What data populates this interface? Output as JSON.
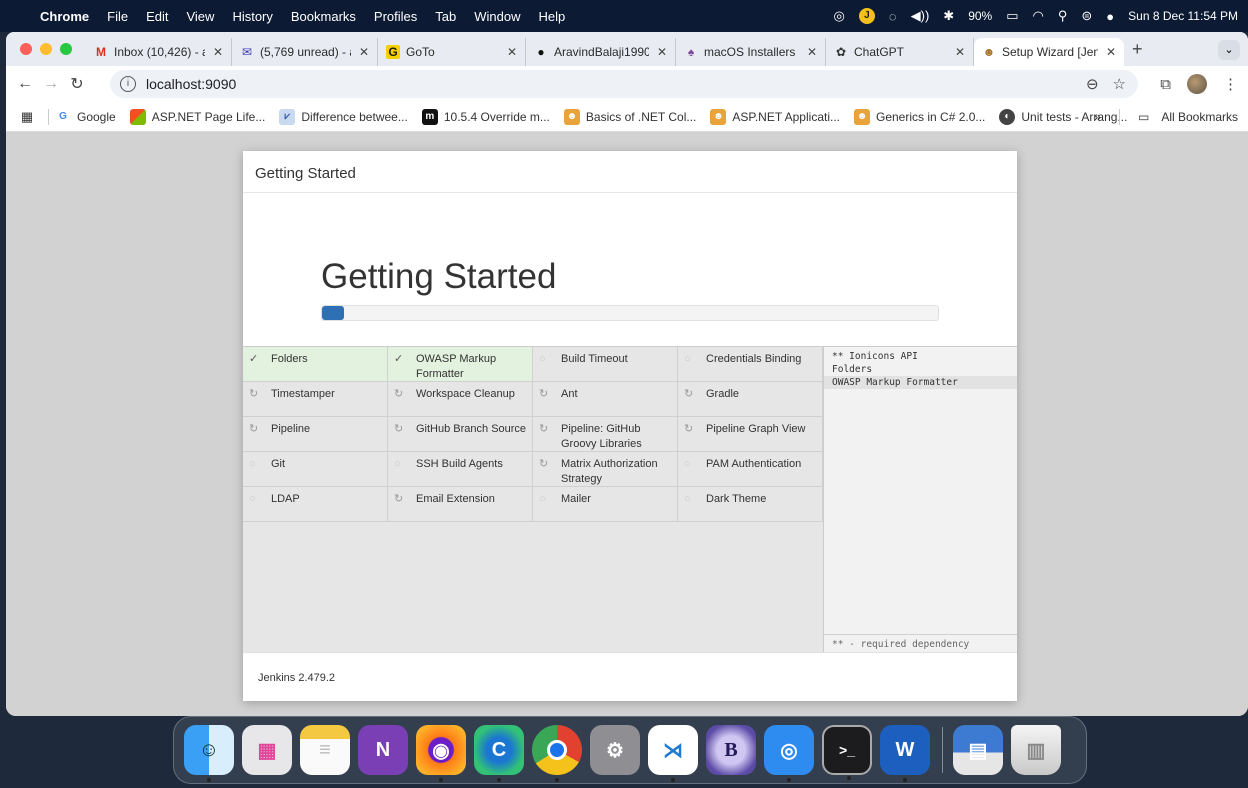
{
  "menubar": {
    "app": "Chrome",
    "items": [
      "File",
      "Edit",
      "View",
      "History",
      "Bookmarks",
      "Profiles",
      "Tab",
      "Window",
      "Help"
    ],
    "battery": "90%",
    "clock": "Sun 8 Dec  11:54 PM"
  },
  "tabs": [
    {
      "label": "Inbox (10,426) - a",
      "icon": "gmail-icon"
    },
    {
      "label": "(5,769 unread) - a",
      "icon": "mail-icon"
    },
    {
      "label": "GoTo",
      "icon": "goto-icon"
    },
    {
      "label": "AravindBalaji1990",
      "icon": "github-icon"
    },
    {
      "label": "macOS Installers f",
      "icon": "apple-icon"
    },
    {
      "label": "ChatGPT",
      "icon": "chatgpt-icon"
    },
    {
      "label": "Setup Wizard [Jen",
      "icon": "jenkins-icon"
    }
  ],
  "address": {
    "url": "localhost:9090"
  },
  "bookmarks": [
    {
      "label": "Google"
    },
    {
      "label": "ASP.NET Page Life..."
    },
    {
      "label": "Difference betwee..."
    },
    {
      "label": "10.5.4 Override m..."
    },
    {
      "label": "Basics of .NET Col..."
    },
    {
      "label": "ASP.NET Applicati..."
    },
    {
      "label": "Generics in C# 2.0..."
    },
    {
      "label": "Unit tests - Arrang..."
    }
  ],
  "bookmarks_more": "»",
  "all_bookmarks": "All Bookmarks",
  "dialog": {
    "header": "Getting Started",
    "hero_title": "Getting Started",
    "progress": 0.035,
    "footer": "Jenkins 2.479.2"
  },
  "plugins": [
    {
      "name": "Folders",
      "status": "done"
    },
    {
      "name": "OWASP Markup Formatter",
      "status": "done"
    },
    {
      "name": "Build Timeout",
      "status": "pending"
    },
    {
      "name": "Credentials Binding",
      "status": "pending"
    },
    {
      "name": "Timestamper",
      "status": "installing"
    },
    {
      "name": "Workspace Cleanup",
      "status": "installing"
    },
    {
      "name": "Ant",
      "status": "installing"
    },
    {
      "name": "Gradle",
      "status": "installing"
    },
    {
      "name": "Pipeline",
      "status": "installing"
    },
    {
      "name": "GitHub Branch Source",
      "status": "installing"
    },
    {
      "name": "Pipeline: GitHub Groovy Libraries",
      "status": "installing"
    },
    {
      "name": "Pipeline Graph View",
      "status": "installing"
    },
    {
      "name": "Git",
      "status": "pending"
    },
    {
      "name": "SSH Build Agents",
      "status": "pending"
    },
    {
      "name": "Matrix Authorization Strategy",
      "status": "installing"
    },
    {
      "name": "PAM Authentication",
      "status": "pending"
    },
    {
      "name": "LDAP",
      "status": "pending"
    },
    {
      "name": "Email Extension",
      "status": "installing"
    },
    {
      "name": "Mailer",
      "status": "pending"
    },
    {
      "name": "Dark Theme",
      "status": "pending"
    }
  ],
  "log": {
    "lines": [
      "** Ionicons API",
      "Folders",
      "OWASP Markup Formatter"
    ],
    "legend": "** - required dependency"
  },
  "dock": [
    "Finder",
    "Launchpad",
    "Notes",
    "OneNote",
    "Firefox",
    "Edge",
    "Chrome",
    "System Settings",
    "VS Code",
    "BBEdit",
    "Cursor",
    "Terminal",
    "Word",
    "Downloads",
    "Trash"
  ]
}
